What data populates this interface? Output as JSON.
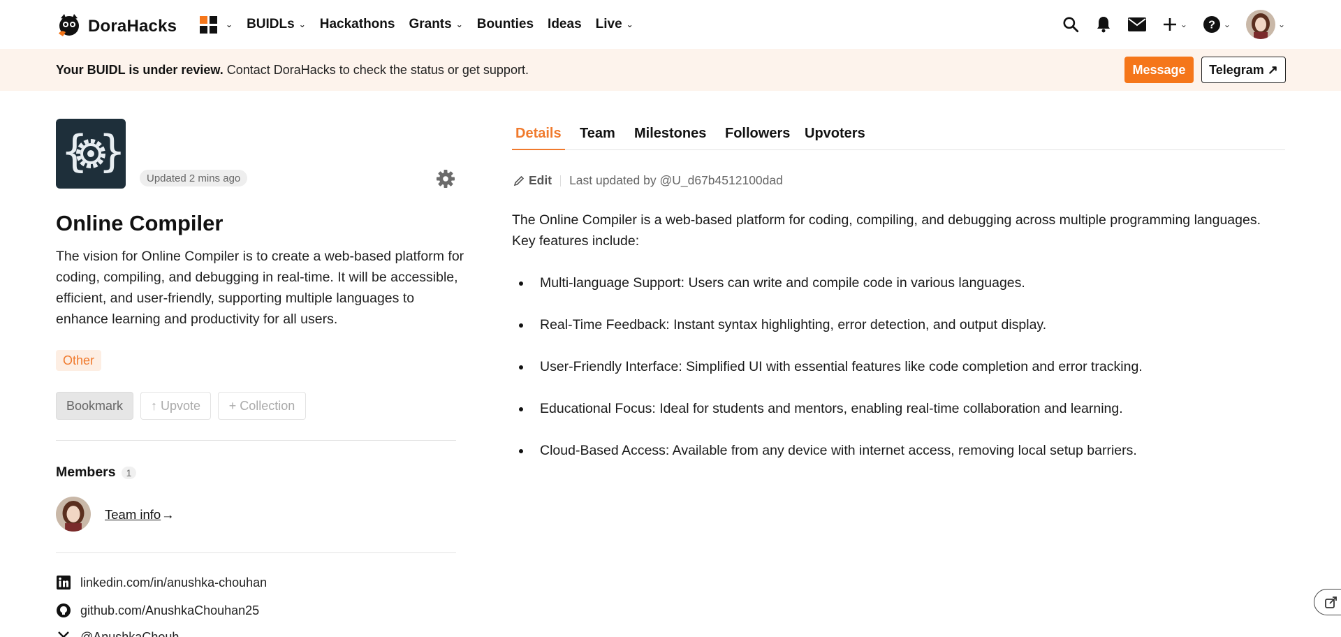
{
  "nav": {
    "brand": "DoraHacks",
    "items": [
      {
        "label": "BUIDLs",
        "has_dropdown": true
      },
      {
        "label": "Hackathons",
        "has_dropdown": false
      },
      {
        "label": "Grants",
        "has_dropdown": true
      },
      {
        "label": "Bounties",
        "has_dropdown": false
      },
      {
        "label": "Ideas",
        "has_dropdown": false
      },
      {
        "label": "Live",
        "has_dropdown": true
      }
    ],
    "right_icons": [
      "search-icon",
      "bell-icon",
      "mail-icon",
      "plus-icon",
      "help-icon",
      "avatar"
    ],
    "apps_icon_colors": [
      "#f5761a",
      "#111111",
      "#111111",
      "#111111"
    ]
  },
  "banner": {
    "bold": "Your BUIDL is under review.",
    "text": " Contact DoraHacks to check the status or get support.",
    "message_label": "Message",
    "telegram_label": "Telegram ↗"
  },
  "project": {
    "updated": "Updated 2 mins ago",
    "title": "Online Compiler",
    "description": "The vision for Online Compiler is to create a web-based platform for coding, compiling, and debugging in real-time. It will be accessible, efficient, and user-friendly, supporting multiple languages to enhance learning and productivity for all users.",
    "tag": "Other",
    "actions": {
      "bookmark": "Bookmark",
      "upvote": "↑ Upvote",
      "collection": "+ Collection"
    },
    "members_title": "Members",
    "members_count": "1",
    "team_info": "Team info",
    "team_info_arrow": "→",
    "socials": [
      {
        "icon": "linkedin-icon",
        "text": "linkedin.com/in/anushka-chouhan"
      },
      {
        "icon": "github-icon",
        "text": "github.com/AnushkaChouhan25"
      },
      {
        "icon": "x-icon",
        "text": "@AnushkaChouh..."
      }
    ]
  },
  "tabs": [
    "Details",
    "Team",
    "Milestones",
    "Followers",
    "Upvoters"
  ],
  "active_tab": "Details",
  "details": {
    "edit_label": "Edit",
    "last_updated": "Last updated by @U_d67b4512100dad",
    "intro": "The Online Compiler is a web-based platform for coding, compiling, and debugging across multiple programming languages. Key features include:",
    "features": [
      "Multi-language Support: Users can write and compile code in various languages.",
      "Real-Time Feedback: Instant syntax highlighting, error detection, and output display.",
      "User-Friendly Interface: Simplified UI with essential features like code completion and error tracking.",
      "Educational Focus: Ideal for students and mentors, enabling real-time collaboration and learning.",
      "Cloud-Based Access: Available from any device with internet access, removing local setup barriers."
    ]
  },
  "colors": {
    "accent": "#f5761a",
    "banner_bg": "#fdf3ec",
    "logo_bg": "#1e2f3a"
  }
}
